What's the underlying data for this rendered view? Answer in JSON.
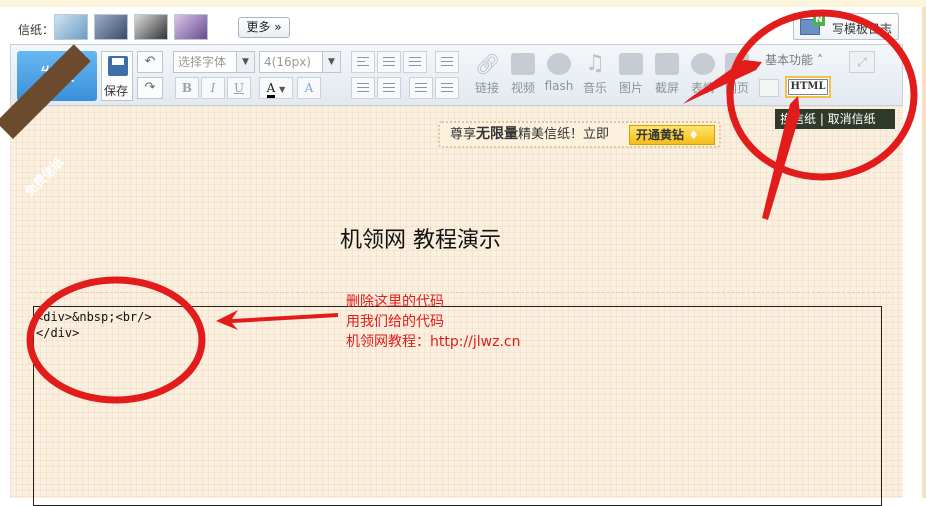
{
  "paper_bar": {
    "label": "信纸：",
    "more": "更多",
    "template_btn": "写模板日志",
    "thumbs": [
      {
        "name": "paper-thumb-1",
        "color": "#7fa8c8"
      },
      {
        "name": "paper-thumb-2",
        "color": "#5a6e88"
      },
      {
        "name": "paper-thumb-3",
        "color": "#4a4a4a"
      },
      {
        "name": "paper-thumb-4",
        "color": "#8c6aa8"
      }
    ]
  },
  "toolbar": {
    "publish": "发表",
    "save": "保存",
    "font_placeholder": "选择字体",
    "size_value": "4(16px)",
    "bold": "B",
    "italic": "I",
    "underline": "U",
    "font_color": "A",
    "highlight": "A",
    "tools": [
      "链接",
      "视频",
      "flash",
      "音乐",
      "图片",
      "截屏",
      "表情",
      "网页"
    ],
    "basic": "基本功能",
    "html": "HTML"
  },
  "paper": {
    "ribbon": "免费信纸",
    "promo_prefix": "尊享",
    "promo_bold": "无限量",
    "promo_suffix": "精美信纸！立即",
    "vip_btn": "开通黄钻",
    "paper_actions": "换信纸 | 取消信纸",
    "doc_title": "机领网 教程演示",
    "editor_lines": [
      "<div>&nbsp;<br/>",
      "</div>"
    ],
    "note_lines": [
      "删除这里的代码",
      "用我们给的代码",
      "机领网教程：http://jlwz.cn"
    ]
  },
  "colors": {
    "publish": "#4a9fe2",
    "annotation": "#e21b1b",
    "paper_bg": "#fbf0df"
  }
}
